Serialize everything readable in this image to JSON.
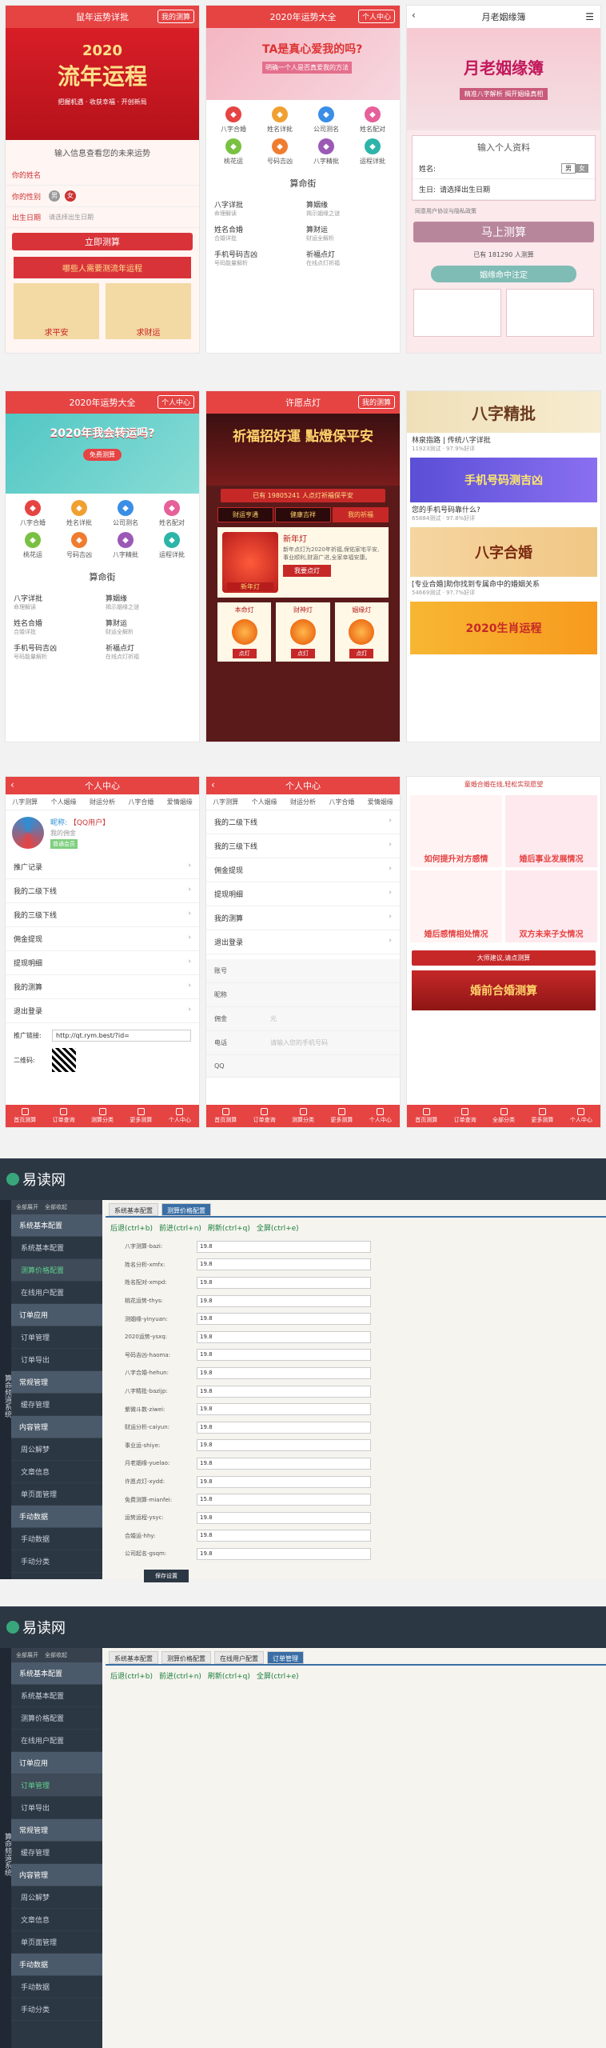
{
  "p1": {
    "title": "鼠年运势详批",
    "btn": "我的测算",
    "year": "2020",
    "big": "流年运程",
    "sub": "把握机遇 · 收获幸福 · 开创新局",
    "prompt": "输入信息查看您的未来运势",
    "name_label": "你的姓名",
    "gender_label": "你的性别",
    "male": "男",
    "female": "女",
    "birth_label": "出生日期",
    "birth_ph": "请选择出生日期",
    "submit": "立即测算",
    "need": "哪些人需要测流年运程",
    "c1": "求平安",
    "c2": "求财运"
  },
  "p2": {
    "title": "2020年运势大全",
    "btn": "个人中心",
    "banner": "TA是真心爱我的吗?",
    "banner_sub": "明确一个人是否真爱我的方法",
    "grid": [
      "八字合婚",
      "姓名详批",
      "公司测名",
      "姓名配对",
      "桃花运",
      "号码吉凶",
      "八字精批",
      "运程详批"
    ],
    "section": "算命街",
    "items": [
      {
        "t": "八字详批",
        "s": "命理解读"
      },
      {
        "t": "算姻缘",
        "s": "揭示姻缘之谜"
      },
      {
        "t": "姓名合婚",
        "s": "合婚详批"
      },
      {
        "t": "算财运",
        "s": "财运全解析"
      },
      {
        "t": "手机号码吉凶",
        "s": "号码能量解析"
      },
      {
        "t": "祈福点灯",
        "s": "在线点灯祈福"
      }
    ]
  },
  "p3": {
    "title": "月老姻缘簿",
    "big": "月老姻缘簿",
    "sub": "精准八字解析 揭开姻缘真相",
    "card": "输入个人资料",
    "name_label": "姓名:",
    "male": "男",
    "female": "女",
    "birth_label": "生日:",
    "birth_ph": "请选择出生日期",
    "agree": "同意用户协议与隐私政策",
    "submit": "马上测算",
    "count": "已有 181290 人测算",
    "mid": "姻缘命中注定"
  },
  "p4": {
    "title": "2020年运势大全",
    "btn": "个人中心",
    "banner": "2020年我会转运吗?",
    "banner_btn": "免费测算",
    "grid": [
      "八字合婚",
      "姓名详批",
      "公司测名",
      "姓名配对",
      "桃花运",
      "号码吉凶",
      "八字精批",
      "运程详批"
    ],
    "section": "算命街",
    "items": [
      {
        "t": "八字详批",
        "s": "命理解读"
      },
      {
        "t": "算姻缘",
        "s": "揭示姻缘之谜"
      },
      {
        "t": "姓名合婚",
        "s": "合婚详批"
      },
      {
        "t": "算财运",
        "s": "财运全解析"
      },
      {
        "t": "手机号码吉凶",
        "s": "号码能量解析"
      },
      {
        "t": "祈福点灯",
        "s": "在线点灯祈福"
      }
    ]
  },
  "p5": {
    "title": "许愿点灯",
    "btn": "我的测算",
    "big": "祈福招好運 點燈保平安",
    "count": "已有 19805241 人点灯祈福保平安",
    "tabs": [
      "财运亨通",
      "健康吉祥",
      "我的祈福"
    ],
    "lamp_name": "新年灯",
    "lamp_desc": "新年点灯为2020年祈福,保佑家宅平安,事业顺利,财源广进,全家幸福安康。",
    "lamp_tag": "新年灯",
    "lamp_btn": "我要点灯",
    "lamps": [
      {
        "n": "本命灯",
        "b": "点灯"
      },
      {
        "n": "财神灯",
        "b": "点灯"
      },
      {
        "n": "姻缘灯",
        "b": "点灯"
      }
    ]
  },
  "p6": {
    "banner1": "八字精批",
    "news": [
      {
        "t": "林泉指路 | 传统八字详批",
        "s": "11923测试 · 97.9%好评"
      },
      {
        "t": "您的手机号码靠什么?",
        "s": "65884测试 · 97.8%好评",
        "banner": "手机号码测吉凶"
      },
      {
        "t": "[专业合婚]助你找到专属命中的婚姻关系",
        "s": "54669测试 · 97.7%好评",
        "banner": "八字合婚"
      },
      {
        "t": "2020生肖运程",
        "s": "",
        "banner": "2020生肖运程"
      }
    ]
  },
  "p7": {
    "title": "个人中心",
    "subtabs": [
      "八字测算",
      "个人姻缘",
      "财运分析",
      "八字合婚",
      "爱情姻缘"
    ],
    "nick_label": "昵称:",
    "nick": "【QQ用户】",
    "uid": "我的佣金",
    "vip": "普通会员",
    "menu": [
      "推广记录",
      "我的二级下线",
      "我的三级下线",
      "佣金提现",
      "提现明细",
      "我的测算",
      "退出登录"
    ],
    "promo_label": "推广链接:",
    "promo_url": "http://qt.rym.best/?id=",
    "qr_label": "二维码:",
    "tabbar": [
      "首页测算",
      "订单查询",
      "测算分类",
      "更多测算",
      "个人中心"
    ]
  },
  "p8": {
    "title": "个人中心",
    "subtabs": [
      "八字测算",
      "个人姻缘",
      "财运分析",
      "八字合婚",
      "爱情姻缘"
    ],
    "menu": [
      "我的二级下线",
      "我的三级下线",
      "佣金提现",
      "提现明细",
      "我的测算",
      "退出登录"
    ],
    "form": [
      {
        "l": "账号",
        "v": ""
      },
      {
        "l": "昵称",
        "v": ""
      },
      {
        "l": "佣金",
        "v": "元"
      },
      {
        "l": "电话",
        "v": "请输入您的手机号码"
      },
      {
        "l": "QQ",
        "v": ""
      }
    ],
    "tabbar": [
      "首页测算",
      "订单查询",
      "测算分类",
      "更多测算",
      "个人中心"
    ]
  },
  "p9": {
    "top": "童婚合婚在线,轻松实现愿望",
    "cells": [
      "如何提升对方感情",
      "婚后事业发展情况",
      "婚后感情相处情况",
      "双方未来子女情况"
    ],
    "ask": "大师建议,请点测算",
    "bottom": "婚前合婚测算",
    "tabbar": [
      "首页测算",
      "订单查询",
      "全部分类",
      "更多测算",
      "个人中心"
    ]
  },
  "admin1": {
    "logo": "易读网",
    "vert": "算命频道系统",
    "tools": [
      "全部展开",
      "全部收起"
    ],
    "menu": [
      {
        "g": "系统基本配置"
      },
      {
        "s": "系统基本配置"
      },
      {
        "s": "测算价格配置",
        "act": true
      },
      {
        "s": "在线用户配置"
      },
      {
        "g": "订单应用"
      },
      {
        "s": "订单管理"
      },
      {
        "s": "订单导出"
      },
      {
        "g": "常规管理"
      },
      {
        "s": "缓存管理"
      },
      {
        "g": "内容管理"
      },
      {
        "s": "周公解梦"
      },
      {
        "s": "文章信息"
      },
      {
        "s": "单页面管理"
      },
      {
        "g": "手动数据"
      },
      {
        "s": "手动数据"
      },
      {
        "s": "手动分类"
      }
    ],
    "tabs": [
      "系统基本配置",
      "测算价格配置"
    ],
    "bar": [
      "后退(ctrl+b)",
      "前进(ctrl+n)",
      "刷新(ctrl+q)",
      "全屏(ctrl+e)"
    ],
    "rows": [
      {
        "l": "八字测算-bazi:",
        "v": "19.8"
      },
      {
        "l": "姓名分析-xmfx:",
        "v": "19.8"
      },
      {
        "l": "姓名配对-xmpd:",
        "v": "19.8"
      },
      {
        "l": "桃花运势-thys:",
        "v": "19.8"
      },
      {
        "l": "测姻缘-yinyuan:",
        "v": "19.8"
      },
      {
        "l": "2020运势-ysxq:",
        "v": "19.8"
      },
      {
        "l": "号码吉凶-haoma:",
        "v": "19.8"
      },
      {
        "l": "八字合婚-hehun:",
        "v": "19.8"
      },
      {
        "l": "八字精批-bazijp:",
        "v": "19.8"
      },
      {
        "l": "紫微斗数-ziwei:",
        "v": "19.8"
      },
      {
        "l": "财运分析-caiyun:",
        "v": "19.8"
      },
      {
        "l": "事业运-shiye:",
        "v": "19.8"
      },
      {
        "l": "月老姻缘-yuelao:",
        "v": "19.8"
      },
      {
        "l": "许愿点灯-xydd:",
        "v": "19.8"
      },
      {
        "l": "免费测算-mianfei:",
        "v": "15.8"
      },
      {
        "l": "运势运程-ysyc:",
        "v": "19.8"
      },
      {
        "l": "合婚运-hhy:",
        "v": "19.8"
      },
      {
        "l": "公司起名-gsqm:",
        "v": "19.8"
      }
    ],
    "save": "保存设置"
  },
  "admin2": {
    "logo": "易读网",
    "vert": "算命频道系统",
    "tools": [
      "全部展开",
      "全部收起"
    ],
    "menu": [
      {
        "g": "系统基本配置"
      },
      {
        "s": "系统基本配置"
      },
      {
        "s": "测算价格配置"
      },
      {
        "s": "在线用户配置"
      },
      {
        "g": "订单应用"
      },
      {
        "s": "订单管理",
        "act": true
      },
      {
        "s": "订单导出"
      },
      {
        "g": "常规管理"
      },
      {
        "s": "缓存管理"
      },
      {
        "g": "内容管理"
      },
      {
        "s": "周公解梦"
      },
      {
        "s": "文章信息"
      },
      {
        "s": "单页面管理"
      },
      {
        "g": "手动数据"
      },
      {
        "s": "手动数据"
      },
      {
        "s": "手动分类"
      }
    ],
    "tabs": [
      "系统基本配置",
      "测算价格配置",
      "在线用户配置",
      "订单管理"
    ],
    "bar": [
      "后退(ctrl+b)",
      "前进(ctrl+n)",
      "刷新(ctrl+q)",
      "全屏(ctrl+e)"
    ]
  }
}
